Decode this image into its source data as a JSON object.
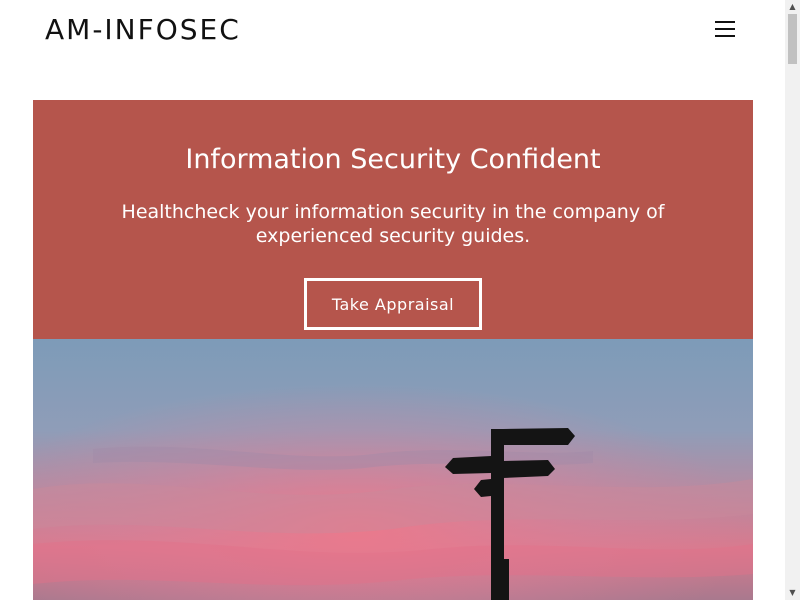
{
  "header": {
    "logo": "AM-INFOSEC",
    "menu_icon": "hamburger-menu-icon"
  },
  "hero": {
    "title": "Information Security Confident",
    "subtitle": "Healthcheck your information security in the company of experienced security guides.",
    "cta_label": "Take Appraisal",
    "background_color": "#b5554c"
  },
  "photo": {
    "subject": "signpost silhouette at sunset"
  },
  "scrollbar": {
    "up_icon": "▲",
    "down_icon": "▼"
  }
}
